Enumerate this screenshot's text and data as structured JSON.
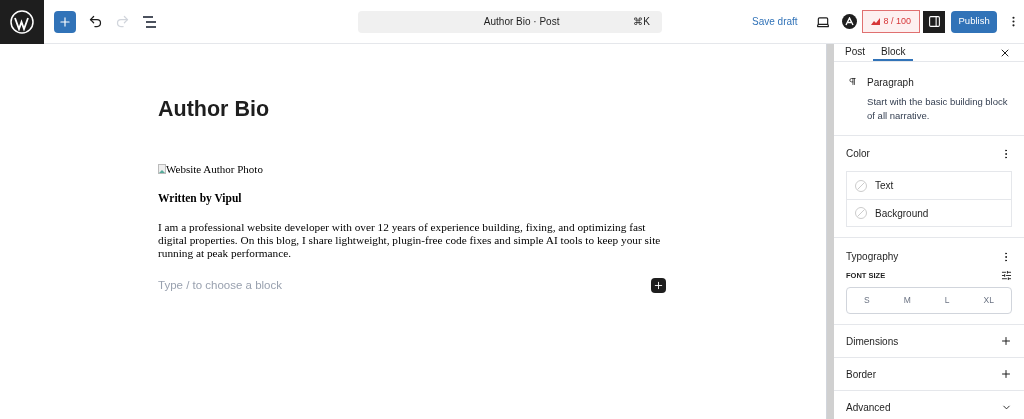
{
  "toolbar": {
    "document_title": "Author Bio · Post",
    "shortcut": "⌘K",
    "save_draft": "Save draft",
    "score": "8 / 100",
    "publish": "Publish",
    "redo_disabled": true,
    "settings_open": true
  },
  "editor": {
    "title": "Author Bio",
    "image_alt": "Website Author Photo",
    "byline": "Written by Vipul",
    "paragraph": "I am a professional website developer with over 12 years of experience building, fixing, and optimizing fast digital properties. On this blog, I share lightweight, plugin-free code fixes and simple AI tools to keep your site running at peak performance.",
    "placeholder": "Type / to choose a block"
  },
  "sidebar": {
    "tabs": [
      {
        "label": "Post",
        "selected": false
      },
      {
        "label": "Block",
        "selected": true
      }
    ],
    "block": {
      "name": "Paragraph",
      "description": "Start with the basic building block of all narrative."
    },
    "color": {
      "title": "Color",
      "items": [
        "Text",
        "Background"
      ]
    },
    "typography": {
      "title": "Typography",
      "font_size_label": "FONT SIZE",
      "sizes": [
        {
          "label": "S",
          "selected": false
        },
        {
          "label": "M",
          "selected": false
        },
        {
          "label": "L",
          "selected": false
        },
        {
          "label": "XL",
          "selected": false
        }
      ]
    },
    "panels": [
      {
        "title": "Dimensions",
        "kind": "add"
      },
      {
        "title": "Border",
        "kind": "add"
      },
      {
        "title": "Advanced",
        "kind": "expand"
      }
    ]
  }
}
